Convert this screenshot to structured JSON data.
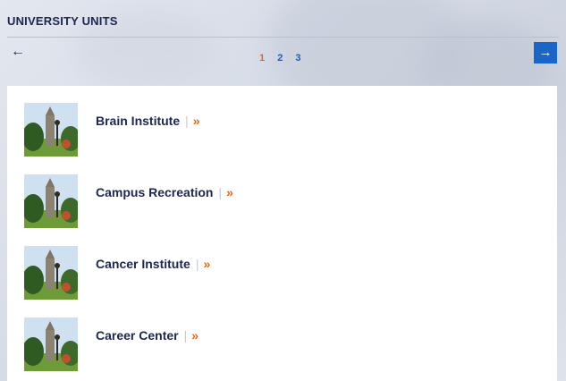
{
  "header": {
    "title": "UNIVERSITY UNITS"
  },
  "pagination": {
    "prev_icon": "←",
    "next_icon": "→",
    "pages": [
      "1",
      "2",
      "3"
    ],
    "current": "1"
  },
  "units": [
    {
      "name": "Brain Institute",
      "separator": "|",
      "link_icon": "»"
    },
    {
      "name": "Campus Recreation",
      "separator": "|",
      "link_icon": "»"
    },
    {
      "name": "Cancer Institute",
      "separator": "|",
      "link_icon": "»"
    },
    {
      "name": "Career Center",
      "separator": "|",
      "link_icon": "»"
    }
  ],
  "colors": {
    "navy": "#1d2553",
    "accent_orange": "#e8651a",
    "link_blue": "#1d5fb8",
    "button_blue": "#1a66c8"
  }
}
